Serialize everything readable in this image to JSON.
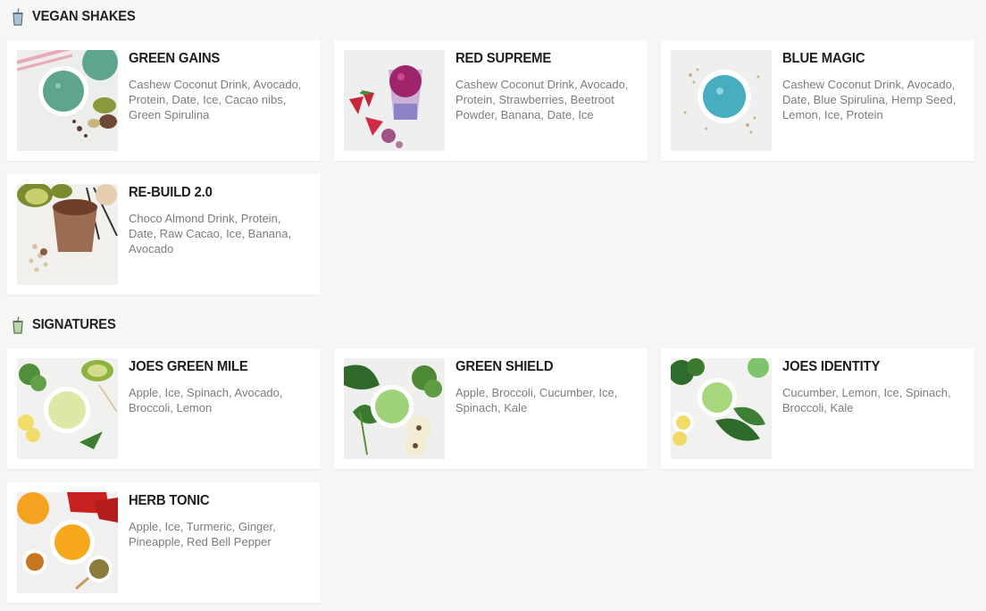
{
  "sections": [
    {
      "title": "VEGAN SHAKES",
      "items": [
        {
          "name": "GREEN GAINS",
          "ingredients": "Cashew Coconut Drink, Avocado, Protein, Date, Ice, Cacao nibs, Green Spirulina",
          "photo": "green-shake-photo"
        },
        {
          "name": "RED SUPREME",
          "ingredients": "Cashew Coconut Drink, Avocado, Protein, Strawberries, Beetroot Powder, Banana, Date, Ice",
          "photo": "red-shake-photo"
        },
        {
          "name": "BLUE MAGIC",
          "ingredients": "Cashew Coconut Drink, Avocado, Date, Blue Spirulina, Hemp Seed, Lemon, Ice, Protein",
          "photo": "blue-shake-photo"
        },
        {
          "name": "RE-BUILD 2.0",
          "ingredients": "Choco Almond Drink, Protein, Date, Raw Cacao, Ice, Banana, Avocado",
          "photo": "chocolate-shake-photo"
        }
      ]
    },
    {
      "title": "SIGNATURES",
      "items": [
        {
          "name": "JOES GREEN MILE",
          "ingredients": "Apple, Ice, Spinach, Avocado, Broccoli, Lemon",
          "photo": "pale-green-juice-photo"
        },
        {
          "name": "GREEN SHIELD",
          "ingredients": "Apple, Broccoli, Cucumber, Ice, Spinach, Kale",
          "photo": "green-juice-photo"
        },
        {
          "name": "JOES IDENTITY",
          "ingredients": "Cucumber, Lemon, Ice, Spinach, Broccoli, Kale",
          "photo": "kale-juice-photo"
        },
        {
          "name": "HERB TONIC",
          "ingredients": "Apple, Ice, Turmeric, Ginger, Pineapple, Red Bell Pepper",
          "photo": "orange-juice-photo"
        }
      ]
    }
  ]
}
